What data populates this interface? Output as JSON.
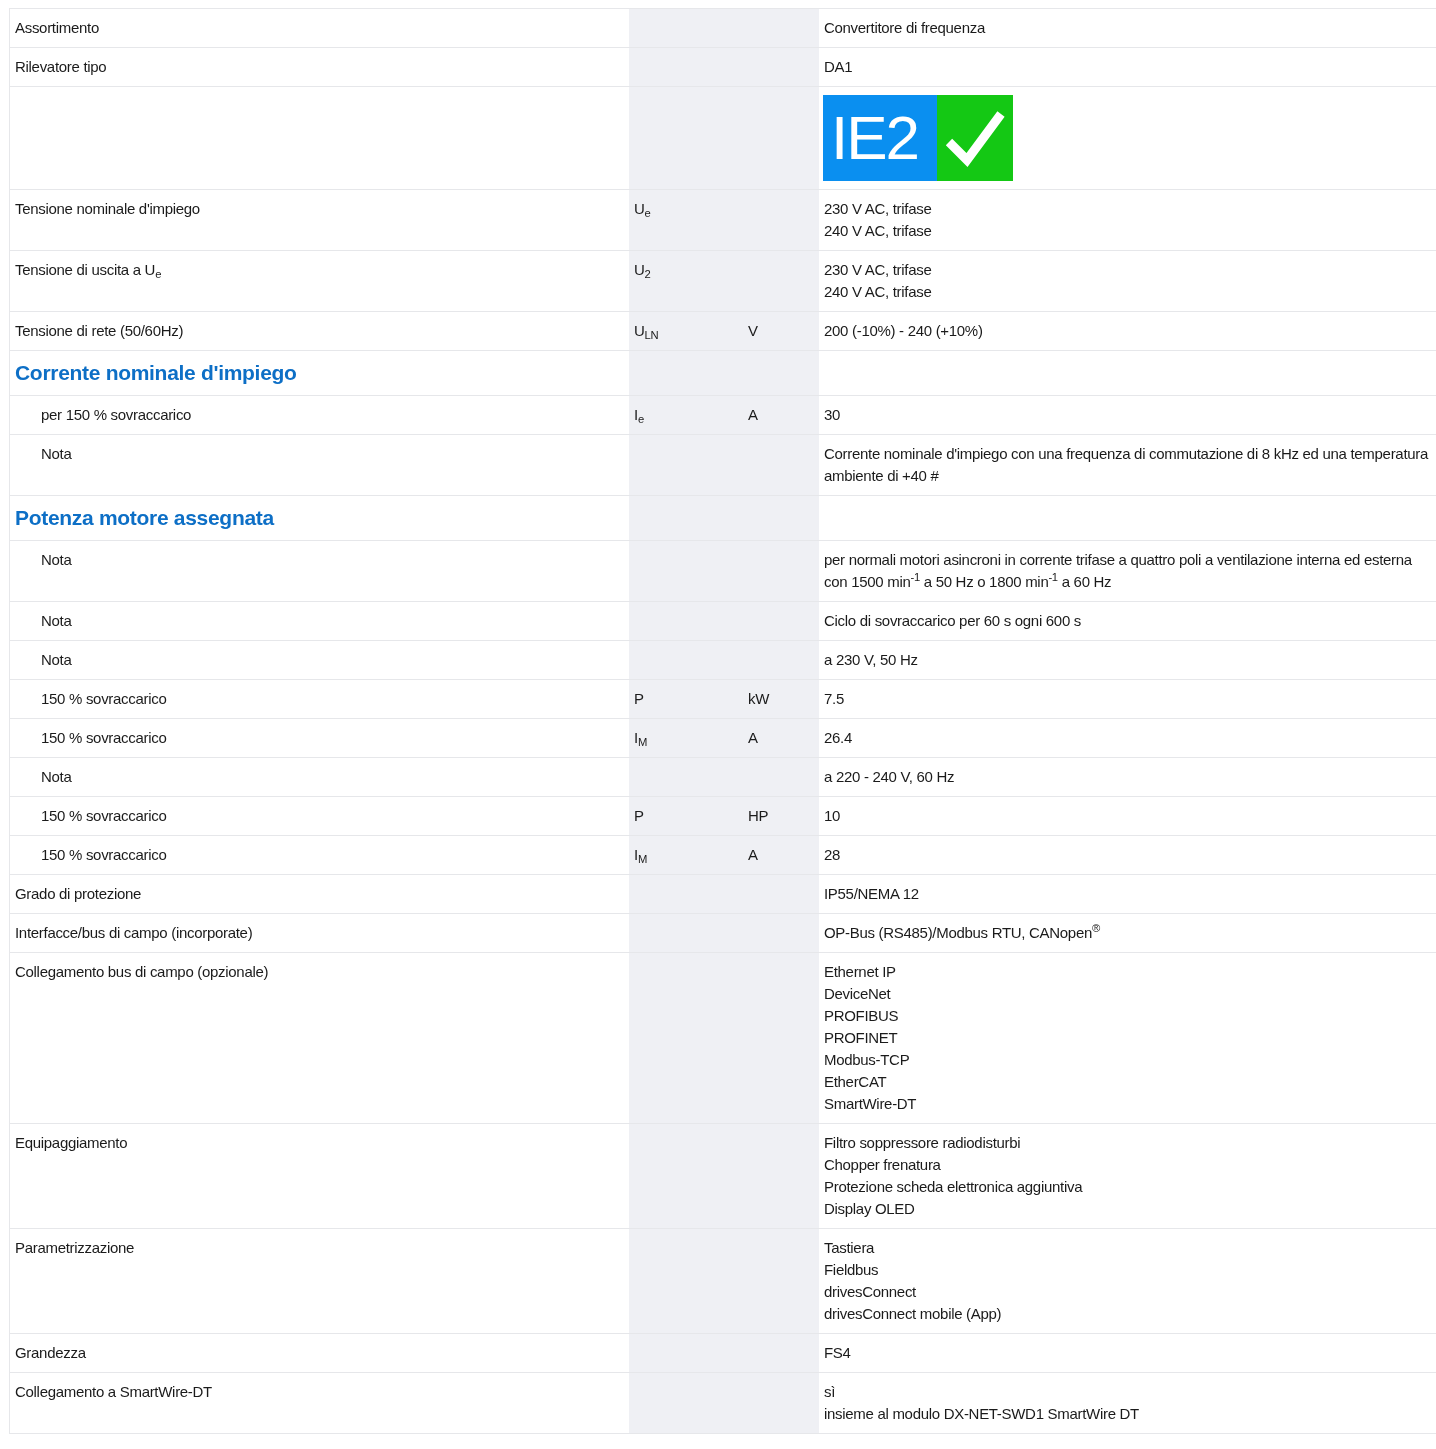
{
  "rows": [
    {
      "kind": "spec",
      "label": "Assortimento",
      "values": [
        "Convertitore di frequenza"
      ]
    },
    {
      "kind": "spec",
      "label": "Rilevatore tipo",
      "values": [
        "DA1"
      ]
    },
    {
      "kind": "badge",
      "badge": "IE2"
    },
    {
      "kind": "spec",
      "label": "Tensione nominale d'impiego",
      "symbol": "U$_{e}$",
      "values": [
        "230 V AC, trifase",
        "240 V AC, trifase"
      ]
    },
    {
      "kind": "spec",
      "label": "Tensione di uscita a U$_{e}$",
      "symbol": "U$_{2}$",
      "values": [
        "230 V AC, trifase",
        "240 V AC, trifase"
      ]
    },
    {
      "kind": "spec",
      "label": "Tensione di rete (50/60Hz)",
      "symbol": "U$_{LN}$",
      "unit": "V",
      "values": [
        "200 (-10%) - 240 (+10%)"
      ]
    },
    {
      "kind": "heading",
      "label": "Corrente nominale d'impiego",
      "children": [
        {
          "kind": "spec",
          "label": "per 150 % sovraccarico",
          "symbol": "I$_{e}$",
          "unit": "A",
          "values": [
            "30"
          ]
        },
        {
          "kind": "spec",
          "label": "Nota",
          "values": [
            "Corrente nominale d'impiego con una frequenza di commutazione di 8 kHz ed una temperatura ambiente di +40 #"
          ]
        }
      ]
    },
    {
      "kind": "heading",
      "label": "Potenza motore assegnata",
      "children": [
        {
          "kind": "spec",
          "label": "Nota",
          "values": [
            "per normali motori asincroni in corrente trifase a quattro poli a ventilazione interna ed esterna con 1500 min$^{-1}$ a 50 Hz o 1800 min$^{-1}$ a 60 Hz"
          ]
        },
        {
          "kind": "spec",
          "label": "Nota",
          "values": [
            "Ciclo di sovraccarico per 60 s ogni 600 s"
          ]
        },
        {
          "kind": "spec",
          "label": "Nota",
          "values": [
            "a 230 V, 50 Hz"
          ]
        },
        {
          "kind": "spec",
          "label": "150 % sovraccarico",
          "symbol": "P",
          "unit": "kW",
          "values": [
            "7.5"
          ]
        },
        {
          "kind": "spec",
          "label": "150 % sovraccarico",
          "symbol": "I$_{M}$",
          "unit": "A",
          "values": [
            "26.4"
          ]
        },
        {
          "kind": "spec",
          "label": "Nota",
          "values": [
            "a 220 - 240 V, 60 Hz"
          ]
        },
        {
          "kind": "spec",
          "label": "150 % sovraccarico",
          "symbol": "P",
          "unit": "HP",
          "values": [
            "10"
          ]
        },
        {
          "kind": "spec",
          "label": "150 % sovraccarico",
          "symbol": "I$_{M}$",
          "unit": "A",
          "values": [
            "28"
          ]
        }
      ]
    },
    {
      "kind": "spec",
      "label": "Grado di protezione",
      "values": [
        "IP55/NEMA 12"
      ]
    },
    {
      "kind": "spec",
      "label": "Interfacce/bus di campo (incorporate)",
      "values": [
        "OP-Bus (RS485)/Modbus RTU, CANopen$^{®}$"
      ]
    },
    {
      "kind": "spec",
      "label": "Collegamento bus di campo (opzionale)",
      "values": [
        "Ethernet IP",
        "DeviceNet",
        "PROFIBUS",
        "PROFINET",
        "Modbus-TCP",
        "EtherCAT",
        "SmartWire-DT"
      ]
    },
    {
      "kind": "spec",
      "label": "Equipaggiamento",
      "values": [
        "Filtro soppressore radiodisturbi",
        "Chopper frenatura",
        "Protezione scheda elettronica aggiuntiva",
        "Display OLED"
      ]
    },
    {
      "kind": "spec",
      "label": "Parametrizzazione",
      "values": [
        "Tastiera",
        "Fieldbus",
        "drivesConnect",
        "drivesConnect mobile (App)"
      ]
    },
    {
      "kind": "spec",
      "label": "Grandezza",
      "values": [
        "FS4"
      ]
    },
    {
      "kind": "spec",
      "label": "Collegamento a SmartWire-DT",
      "values": [
        "sì",
        "insieme al modulo DX-NET-SWD1 SmartWire DT"
      ]
    }
  ]
}
